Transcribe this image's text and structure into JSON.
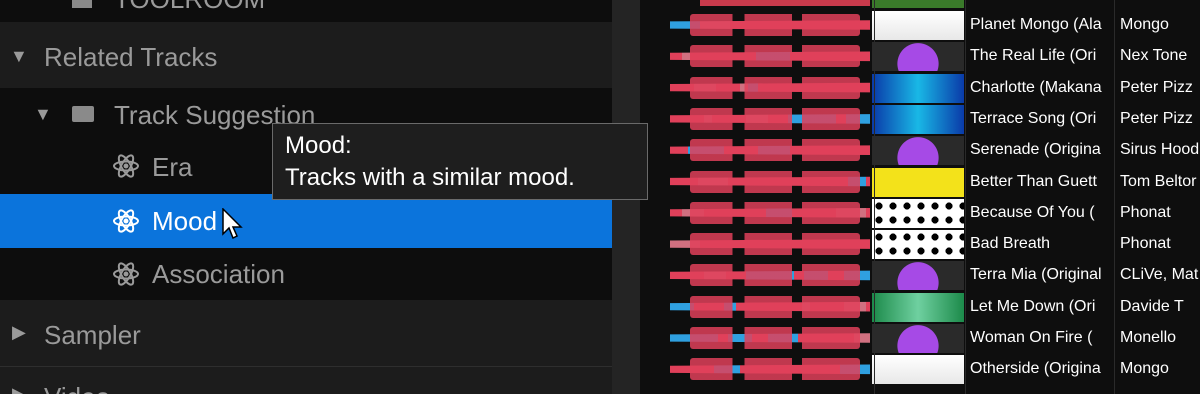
{
  "sidebar": {
    "partial_top_label": "TOOLROOM",
    "related_tracks": "Related Tracks",
    "track_suggestion": "Track Suggestion",
    "era": "Era",
    "mood": "Mood",
    "association": "Association",
    "sampler": "Sampler",
    "partial_bottom_label": "Video"
  },
  "tooltip": {
    "title": "Mood:",
    "body": "Tracks with a similar mood."
  },
  "tracks": [
    {
      "title": "Planet Mongo (Ala",
      "artist": "Mongo",
      "art": "white"
    },
    {
      "title": "The Real Life (Ori",
      "artist": "Nex Tone",
      "art": "purple"
    },
    {
      "title": "Charlotte (Makana",
      "artist": "Peter Pizz",
      "art": "blue"
    },
    {
      "title": "Terrace Song (Ori",
      "artist": "Peter Pizz",
      "art": "blue"
    },
    {
      "title": "Serenade (Origina",
      "artist": "Sirus Hood",
      "art": "purple"
    },
    {
      "title": "Better Than Guett",
      "artist": "Tom Beltor",
      "art": "yellow"
    },
    {
      "title": "Because Of You (",
      "artist": "Phonat",
      "art": "dots"
    },
    {
      "title": "Bad Breath",
      "artist": "Phonat",
      "art": "dots"
    },
    {
      "title": "Terra Mia (Original",
      "artist": "CLiVe, Mat",
      "art": "purple"
    },
    {
      "title": "Let Me Down (Ori",
      "artist": "Davide T",
      "art": "green"
    },
    {
      "title": "Woman On Fire (",
      "artist": "Monello",
      "art": "purple"
    },
    {
      "title": "Otherside (Origina",
      "artist": "Mongo",
      "art": "white"
    }
  ],
  "colors": {
    "selection": "#0b74dc",
    "waveform_primary": "#e0405a",
    "waveform_secondary": "#2fa0e0"
  }
}
